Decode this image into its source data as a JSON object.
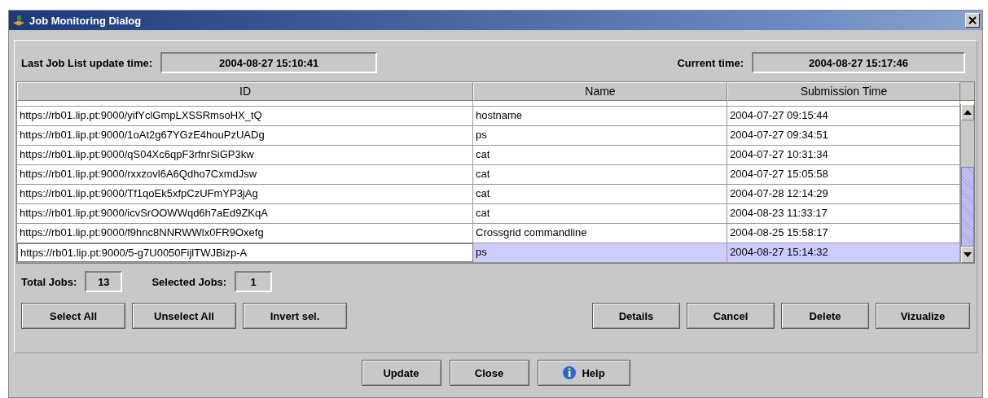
{
  "window": {
    "title": "Job Monitoring Dialog"
  },
  "last_update": {
    "label": "Last Job List update time:",
    "value": "2004-08-27 15:10:41"
  },
  "current_time": {
    "label": "Current time:",
    "value": "2004-08-27 15:17:46"
  },
  "table": {
    "columns": [
      "ID",
      "Name",
      "Submission Time"
    ],
    "rows": [
      {
        "id": "https://rb01.lip.pt:9000/yifYclGmpLXSSRmsoHX_tQ",
        "name": "hostname",
        "time": "2004-07-27 09:15:44",
        "selected": false
      },
      {
        "id": "https://rb01.lip.pt:9000/1oAt2g67YGzE4houPzUADg",
        "name": "ps",
        "time": "2004-07-27 09:34:51",
        "selected": false
      },
      {
        "id": "https://rb01.lip.pt:9000/qS04Xc6qpF3rfnrSiGP3kw",
        "name": "cat",
        "time": "2004-07-27 10:31:34",
        "selected": false
      },
      {
        "id": "https://rb01.lip.pt:9000/rxxzovl6A6Qdho7CxmdJsw",
        "name": "cat",
        "time": "2004-07-27 15:05:58",
        "selected": false
      },
      {
        "id": "https://rb01.lip.pt:9000/Tf1qoEk5xfpCzUFmYP3jAg",
        "name": "cat",
        "time": "2004-07-28 12:14:29",
        "selected": false
      },
      {
        "id": "https://rb01.lip.pt:9000/icvSrOOWWqd6h7aEd9ZKqA",
        "name": "cat",
        "time": "2004-08-23 11:33:17",
        "selected": false
      },
      {
        "id": "https://rb01.lip.pt:9000/f9hnc8NNRWWlx0FR9Oxefg",
        "name": "Crossgrid commandline",
        "time": "2004-08-25 15:58:17",
        "selected": false
      },
      {
        "id": "https://rb01.lip.pt:9000/5-g7U0050FijlTWJBizp-A",
        "name": "ps",
        "time": "2004-08-27 15:14:32",
        "selected": true
      }
    ]
  },
  "total_jobs": {
    "label": "Total Jobs:",
    "value": "13"
  },
  "selected_jobs": {
    "label": "Selected Jobs:",
    "value": "1"
  },
  "selection_buttons": [
    "Select All",
    "Unselect All",
    "Invert sel."
  ],
  "action_buttons": [
    "Details",
    "Cancel",
    "Delete",
    "Vizualize"
  ],
  "footer_buttons": [
    {
      "label": "Update",
      "kind": "plain"
    },
    {
      "label": "Close",
      "kind": "plain"
    },
    {
      "label": "Help",
      "kind": "help"
    }
  ]
}
